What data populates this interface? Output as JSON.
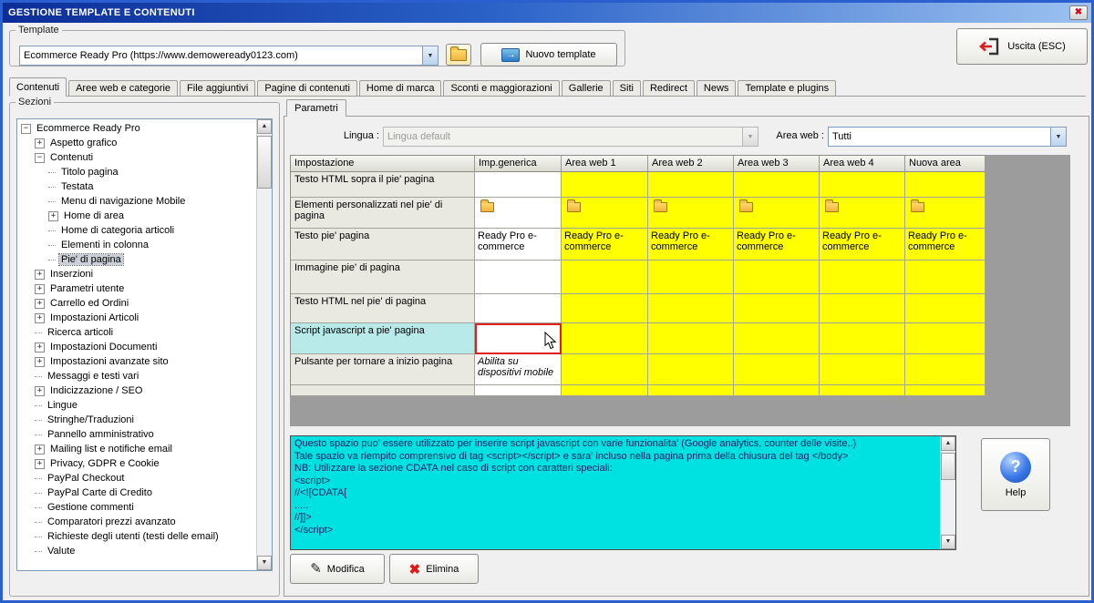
{
  "window": {
    "title": "GESTIONE TEMPLATE E CONTENUTI"
  },
  "icons": {
    "close": "✖",
    "combo_arrow": "▼",
    "scroll_up": "▲",
    "scroll_down": "▼",
    "arrow_right": "→",
    "pencil": "✎",
    "delete": "✖",
    "question": "?"
  },
  "colors": {
    "titlebar-left": "#0c2d97",
    "titlebar-mid": "#2a62c8",
    "titlebar-right": "#9cc2f0",
    "window-border": "#2b5fd0",
    "yellow": "#ffff00",
    "cyan-info": "#00e1e1",
    "sel-cyan": "#b9eaea",
    "focus-red": "#e02020",
    "backdrop": "#9c9c9c"
  },
  "template_bar": {
    "group_label": "Template",
    "combo_value": "Ecommerce Ready Pro (https://www.demoweready0123.com)",
    "new_template_label": "Nuovo template",
    "exit_label": "Uscita (ESC)"
  },
  "tabs": [
    {
      "label": "Contenuti",
      "selected": true
    },
    {
      "label": "Aree web e categorie"
    },
    {
      "label": "File aggiuntivi"
    },
    {
      "label": "Pagine di contenuti"
    },
    {
      "label": "Home di marca"
    },
    {
      "label": "Sconti e maggiorazioni"
    },
    {
      "label": "Gallerie"
    },
    {
      "label": "Siti"
    },
    {
      "label": "Redirect"
    },
    {
      "label": "News"
    },
    {
      "label": "Template e plugins"
    }
  ],
  "sections": {
    "group_label": "Sezioni",
    "items": [
      {
        "label": "Ecommerce Ready Pro",
        "level": 0,
        "expand": "-"
      },
      {
        "label": "Aspetto grafico",
        "level": 1,
        "expand": "+"
      },
      {
        "label": "Contenuti",
        "level": 1,
        "expand": "-"
      },
      {
        "label": "Titolo pagina",
        "level": 2
      },
      {
        "label": "Testata",
        "level": 2
      },
      {
        "label": "Menu di navigazione Mobile",
        "level": 2
      },
      {
        "label": "Home di area",
        "level": 2,
        "expand": "+"
      },
      {
        "label": "Home di categoria articoli",
        "level": 2
      },
      {
        "label": "Elementi in colonna",
        "level": 2
      },
      {
        "label": "Pie' di pagina",
        "level": 2,
        "selected": true
      },
      {
        "label": "Inserzioni",
        "level": 1,
        "expand": "+"
      },
      {
        "label": "Parametri utente",
        "level": 1,
        "expand": "+"
      },
      {
        "label": "Carrello ed Ordini",
        "level": 1,
        "expand": "+"
      },
      {
        "label": "Impostazioni Articoli",
        "level": 1,
        "expand": "+"
      },
      {
        "label": "Ricerca articoli",
        "level": 1
      },
      {
        "label": "Impostazioni Documenti",
        "level": 1,
        "expand": "+"
      },
      {
        "label": "Impostazioni avanzate sito",
        "level": 1,
        "expand": "+"
      },
      {
        "label": "Messaggi e testi vari",
        "level": 1
      },
      {
        "label": "Indicizzazione / SEO",
        "level": 1,
        "expand": "+"
      },
      {
        "label": "Lingue",
        "level": 1
      },
      {
        "label": "Stringhe/Traduzioni",
        "level": 1
      },
      {
        "label": "Pannello amministrativo",
        "level": 1
      },
      {
        "label": "Mailing list e notifiche email",
        "level": 1,
        "expand": "+"
      },
      {
        "label": "Privacy, GDPR e Cookie",
        "level": 1,
        "expand": "+"
      },
      {
        "label": "PayPal Checkout",
        "level": 1
      },
      {
        "label": "PayPal Carte di Credito",
        "level": 1
      },
      {
        "label": "Gestione commenti",
        "level": 1
      },
      {
        "label": "Comparatori prezzi avanzato",
        "level": 1
      },
      {
        "label": "Richieste degli utenti (testi delle email)",
        "level": 1
      },
      {
        "label": "Valute",
        "level": 1
      }
    ]
  },
  "parameters": {
    "tab_label": "Parametri",
    "language_label": "Lingua :",
    "language_value": "Lingua default",
    "areaweb_label": "Area web :",
    "areaweb_value": "Tutti",
    "table": {
      "columns": [
        "Impostazione",
        "Imp.generica",
        "Area web 1",
        "Area web 2",
        "Area web 3",
        "Area web 4",
        "Nuova area"
      ],
      "rows": [
        {
          "label": "Testo HTML sopra il pie' pagina",
          "cells": [
            {},
            {},
            {},
            {},
            {},
            {}
          ]
        },
        {
          "label": "Elementi personalizzati nel pie' di pagina",
          "cells": [
            {
              "icon": "folder"
            },
            {
              "icon": "folder"
            },
            {
              "icon": "folder"
            },
            {
              "icon": "folder"
            },
            {
              "icon": "folder"
            },
            {
              "icon": "folder"
            }
          ]
        },
        {
          "label": "Testo pie' pagina",
          "cells": [
            {
              "text": "Ready Pro e-commerce"
            },
            {
              "text": "Ready Pro e-commerce"
            },
            {
              "text": "Ready Pro e-commerce"
            },
            {
              "text": "Ready Pro e-commerce"
            },
            {
              "text": "Ready Pro e-commerce"
            },
            {
              "text": "Ready Pro e-commerce"
            }
          ]
        },
        {
          "label": "Immagine pie' di pagina",
          "cells": [
            {},
            {},
            {},
            {},
            {},
            {}
          ]
        },
        {
          "label": "Testo HTML nel pie' di pagina",
          "cells": [
            {},
            {},
            {},
            {},
            {},
            {}
          ]
        },
        {
          "label": "Script javascript a pie' pagina",
          "selected": true,
          "cells": [
            {
              "focused": true
            },
            {},
            {},
            {},
            {},
            {}
          ]
        },
        {
          "label": "Pulsante per tornare a inizio pagina",
          "cells": [
            {
              "text": "Abilita su dispositivi mobile",
              "italic": true
            },
            {},
            {},
            {},
            {},
            {}
          ]
        }
      ]
    },
    "info_lines": [
      "Questo spazio puo' essere utilizzato per inserire script javascript con varie funzionalita' (Google analytics, counter delle visite..)",
      "Tale spazio va riempito comprensivo di tag <script></script> e sara' incluso nella pagina prima della chiusura del tag </body>",
      "NB: Utilizzare la sezione CDATA nel caso di script con caratteri speciali:",
      "<script>",
      "//<![CDATA[",
      ".....",
      "//]]>",
      "</script>"
    ],
    "help_label": "Help",
    "modify_label": "Modifica",
    "delete_label": "Elimina"
  }
}
